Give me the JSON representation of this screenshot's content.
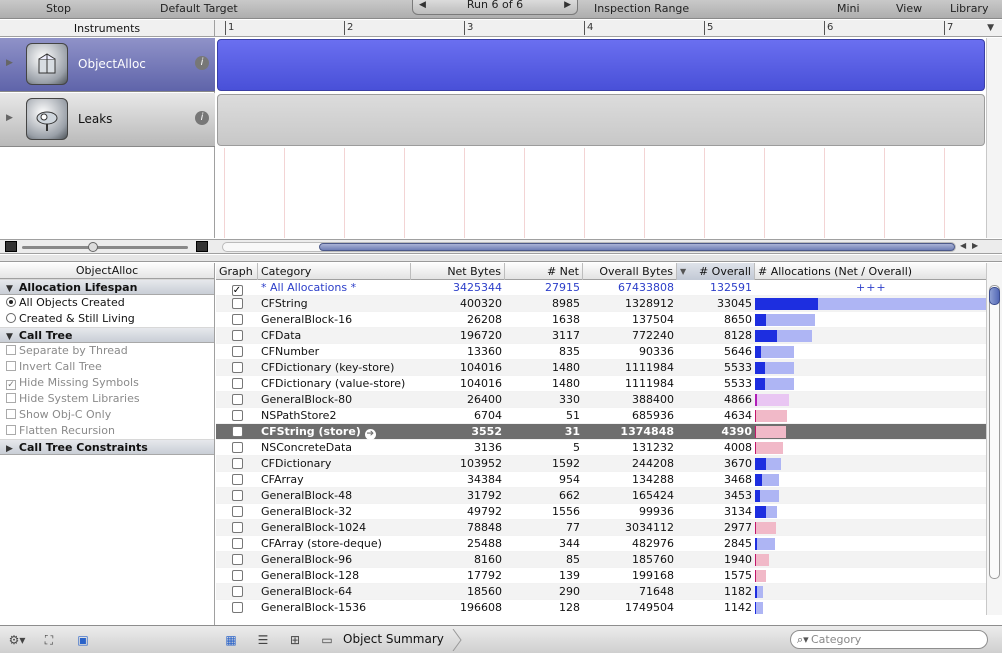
{
  "toolbar": {
    "stop_label": "Stop",
    "target_label": "Default Target",
    "run_label": "Run 6 of 6",
    "inspection_label": "Inspection Range",
    "mini_label": "Mini",
    "view_label": "View",
    "library_label": "Library"
  },
  "timeline": {
    "instruments_header": "Instruments",
    "ticks": [
      "1",
      "2",
      "3",
      "4",
      "5",
      "6",
      "7"
    ],
    "instruments": [
      {
        "name": "ObjectAlloc",
        "info": "i"
      },
      {
        "name": "Leaks",
        "info": "i"
      }
    ]
  },
  "detail": {
    "title": "ObjectAlloc",
    "allocation_lifespan": {
      "header": "Allocation Lifespan",
      "options": [
        "All Objects Created",
        "Created & Still Living"
      ],
      "selected": 0
    },
    "call_tree": {
      "header": "Call Tree",
      "options": [
        {
          "label": "Separate by Thread",
          "checked": false
        },
        {
          "label": "Invert Call Tree",
          "checked": false
        },
        {
          "label": "Hide Missing Symbols",
          "checked": true
        },
        {
          "label": "Hide System Libraries",
          "checked": false
        },
        {
          "label": "Show Obj-C Only",
          "checked": false
        },
        {
          "label": "Flatten Recursion",
          "checked": false
        }
      ]
    },
    "constraints_header": "Call Tree Constraints"
  },
  "table": {
    "columns": {
      "graph": "Graph",
      "category": "Category",
      "net_bytes": "Net Bytes",
      "num_net": "# Net",
      "overall_bytes": "Overall Bytes",
      "num_overall": "# Overall",
      "allocations": "# Allocations (Net / Overall)"
    },
    "totals": {
      "graph": true,
      "category": "* All Allocations *",
      "net_bytes": "3425344",
      "num_net": "27915",
      "overall_bytes": "67433808",
      "num_overall": "132591",
      "marker": "+++"
    },
    "rows": [
      {
        "category": "CFString",
        "net_bytes": "400320",
        "num_net": "8985",
        "overall_bytes": "1328912",
        "num_overall": "33045",
        "bar_net": 8985,
        "bar_overall": 33045,
        "bar_color": "blue"
      },
      {
        "category": "GeneralBlock-16",
        "net_bytes": "26208",
        "num_net": "1638",
        "overall_bytes": "137504",
        "num_overall": "8650",
        "bar_net": 1638,
        "bar_overall": 8650,
        "bar_color": "blue"
      },
      {
        "category": "CFData",
        "net_bytes": "196720",
        "num_net": "3117",
        "overall_bytes": "772240",
        "num_overall": "8128",
        "bar_net": 3117,
        "bar_overall": 8128,
        "bar_color": "blue"
      },
      {
        "category": "CFNumber",
        "net_bytes": "13360",
        "num_net": "835",
        "overall_bytes": "90336",
        "num_overall": "5646",
        "bar_net": 835,
        "bar_overall": 5646,
        "bar_color": "blue"
      },
      {
        "category": "CFDictionary (key-store)",
        "net_bytes": "104016",
        "num_net": "1480",
        "overall_bytes": "1111984",
        "num_overall": "5533",
        "bar_net": 1480,
        "bar_overall": 5533,
        "bar_color": "blue"
      },
      {
        "category": "CFDictionary (value-store)",
        "net_bytes": "104016",
        "num_net": "1480",
        "overall_bytes": "1111984",
        "num_overall": "5533",
        "bar_net": 1480,
        "bar_overall": 5533,
        "bar_color": "blue"
      },
      {
        "category": "GeneralBlock-80",
        "net_bytes": "26400",
        "num_net": "330",
        "overall_bytes": "388400",
        "num_overall": "4866",
        "bar_net": 330,
        "bar_overall": 4866,
        "bar_color": "lilac"
      },
      {
        "category": "NSPathStore2",
        "net_bytes": "6704",
        "num_net": "51",
        "overall_bytes": "685936",
        "num_overall": "4634",
        "bar_net": 51,
        "bar_overall": 4634,
        "bar_color": "pink"
      },
      {
        "category": "CFString (store)",
        "net_bytes": "3552",
        "num_net": "31",
        "overall_bytes": "1374848",
        "num_overall": "4390",
        "bar_net": 31,
        "bar_overall": 4390,
        "bar_color": "pink",
        "selected": true
      },
      {
        "category": "NSConcreteData",
        "net_bytes": "3136",
        "num_net": "5",
        "overall_bytes": "131232",
        "num_overall": "4008",
        "bar_net": 5,
        "bar_overall": 4008,
        "bar_color": "pink"
      },
      {
        "category": "CFDictionary",
        "net_bytes": "103952",
        "num_net": "1592",
        "overall_bytes": "244208",
        "num_overall": "3670",
        "bar_net": 1592,
        "bar_overall": 3670,
        "bar_color": "blue"
      },
      {
        "category": "CFArray",
        "net_bytes": "34384",
        "num_net": "954",
        "overall_bytes": "134288",
        "num_overall": "3468",
        "bar_net": 954,
        "bar_overall": 3468,
        "bar_color": "blue"
      },
      {
        "category": "GeneralBlock-48",
        "net_bytes": "31792",
        "num_net": "662",
        "overall_bytes": "165424",
        "num_overall": "3453",
        "bar_net": 662,
        "bar_overall": 3453,
        "bar_color": "blue"
      },
      {
        "category": "GeneralBlock-32",
        "net_bytes": "49792",
        "num_net": "1556",
        "overall_bytes": "99936",
        "num_overall": "3134",
        "bar_net": 1556,
        "bar_overall": 3134,
        "bar_color": "blue"
      },
      {
        "category": "GeneralBlock-1024",
        "net_bytes": "78848",
        "num_net": "77",
        "overall_bytes": "3034112",
        "num_overall": "2977",
        "bar_net": 77,
        "bar_overall": 2977,
        "bar_color": "pink"
      },
      {
        "category": "CFArray (store-deque)",
        "net_bytes": "25488",
        "num_net": "344",
        "overall_bytes": "482976",
        "num_overall": "2845",
        "bar_net": 344,
        "bar_overall": 2845,
        "bar_color": "blue"
      },
      {
        "category": "GeneralBlock-96",
        "net_bytes": "8160",
        "num_net": "85",
        "overall_bytes": "185760",
        "num_overall": "1940",
        "bar_net": 85,
        "bar_overall": 1940,
        "bar_color": "pink"
      },
      {
        "category": "GeneralBlock-128",
        "net_bytes": "17792",
        "num_net": "139",
        "overall_bytes": "199168",
        "num_overall": "1575",
        "bar_net": 139,
        "bar_overall": 1575,
        "bar_color": "pink"
      },
      {
        "category": "GeneralBlock-64",
        "net_bytes": "18560",
        "num_net": "290",
        "overall_bytes": "71648",
        "num_overall": "1182",
        "bar_net": 290,
        "bar_overall": 1182,
        "bar_color": "blue"
      },
      {
        "category": "GeneralBlock-1536",
        "net_bytes": "196608",
        "num_net": "128",
        "overall_bytes": "1749504",
        "num_overall": "1142",
        "bar_net": 128,
        "bar_overall": 1142,
        "bar_color": "blue"
      }
    ]
  },
  "status_bar": {
    "breadcrumb": "Object Summary",
    "search_placeholder": "Category",
    "icons": [
      "gear-icon",
      "focus-icon",
      "window-icon",
      "table-view-icon",
      "list-view-icon",
      "graph-view-icon",
      "detail-pane-icon",
      "search-icon"
    ]
  },
  "colors": {
    "track_blue": "#4950d8",
    "bar_net_blue": "#1d2ee0",
    "bar_overall_blue": "#aeb5f4",
    "bar_pink": "#f1b9c8",
    "selected_row": "#6e6e6e",
    "totals_text": "#2c3ec9"
  }
}
